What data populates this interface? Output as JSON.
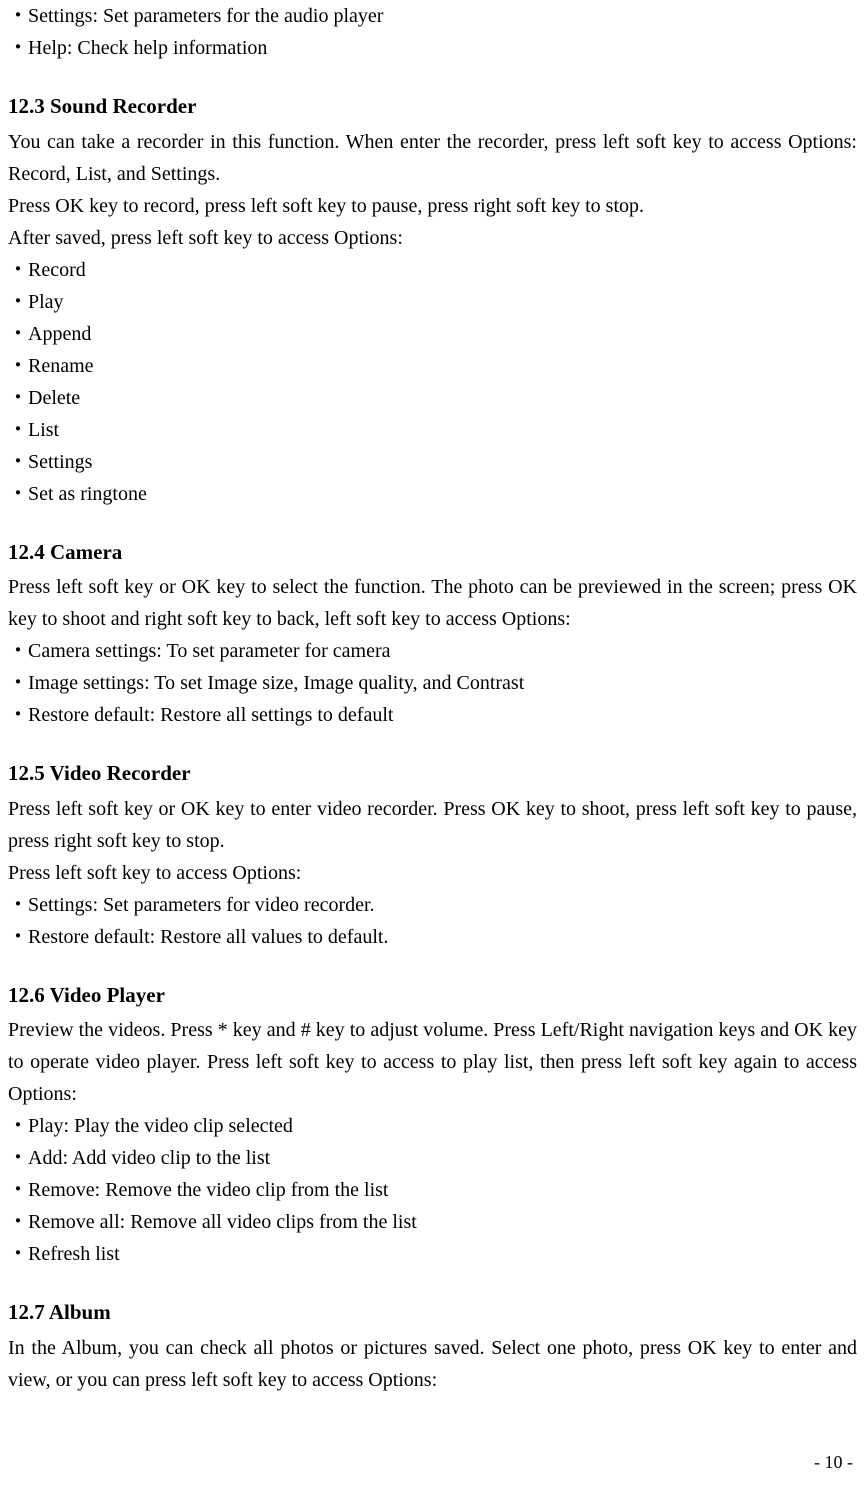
{
  "intro_bullets": [
    "Settings: Set parameters for the audio player",
    "Help: Check help information"
  ],
  "sections": {
    "s12_3": {
      "heading": "12.3 Sound Recorder",
      "para1": "You can take a recorder in this function. When enter the recorder, press left soft key to access Options: Record, List, and Settings.",
      "para2": "Press OK key to record, press left soft key to pause, press right soft key to stop.",
      "para3": "After saved, press left soft key to access Options:",
      "bullets": [
        "Record",
        "Play",
        "Append",
        "Rename",
        "Delete",
        "List",
        "Settings",
        "Set as ringtone"
      ]
    },
    "s12_4": {
      "heading": "12.4 Camera",
      "para1": "Press left soft key or OK key to select the function. The photo can be previewed in the screen; press OK key to shoot and right soft key to back, left soft key to access Options:",
      "bullets": [
        "Camera settings: To set parameter for camera",
        "Image settings: To set Image size, Image quality, and Contrast",
        "Restore default: Restore all settings to default"
      ]
    },
    "s12_5": {
      "heading": "12.5 Video Recorder",
      "para1": "Press left soft key or OK key to enter video recorder. Press OK key to shoot, press left soft key to pause, press right soft key to stop.",
      "para2": "Press left soft key to access Options:",
      "bullets": [
        "Settings: Set parameters for video recorder.",
        "Restore default: Restore all values to default."
      ]
    },
    "s12_6": {
      "heading": "12.6 Video Player",
      "para1": "Preview the videos. Press * key and # key to adjust volume. Press Left/Right navigation keys and OK key to operate video player. Press left soft key to access to play list, then press left soft key again to access Options:",
      "bullets": [
        "Play: Play the video clip selected",
        "Add: Add video clip to the list",
        "Remove: Remove the video clip from the list",
        "Remove all: Remove all video clips from the list",
        "Refresh list"
      ]
    },
    "s12_7": {
      "heading": "12.7 Album",
      "para1": "In the Album, you can check all photos or pictures saved. Select one photo, press OK key to enter and view, or you can press left soft key to access Options:"
    }
  },
  "footer": "- 10 -",
  "bullet_char": "・"
}
